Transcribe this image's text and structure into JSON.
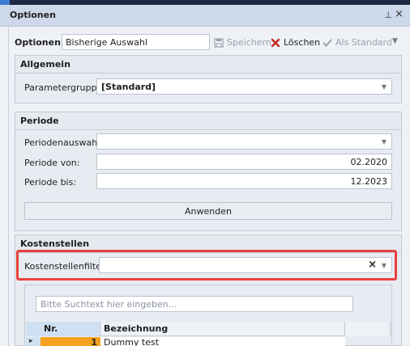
{
  "window": {
    "title": "Optionen",
    "pin_glyph": "⊥",
    "close_glyph": "×"
  },
  "options_bar": {
    "label": "Optionen:",
    "value": "Bisherige Auswahl",
    "save_label": "Speichern",
    "delete_label": "Löschen",
    "standard_label": "Als Standard",
    "icons": {
      "save": "save-icon",
      "delete": "delete-icon",
      "standard": "checkmark-icon"
    }
  },
  "allgemein": {
    "heading": "Allgemein",
    "param_label": "Parametergruppe:",
    "param_value": "[Standard]"
  },
  "periode": {
    "heading": "Periode",
    "auswahl_label": "Periodenauswahl:",
    "auswahl_value": "",
    "von_label": "Periode von:",
    "von_value": "02.2020",
    "bis_label": "Periode bis:",
    "bis_value": "12.2023",
    "apply_label": "Anwenden"
  },
  "kostenstellen": {
    "heading": "Kostenstellen",
    "filter_label": "Kostenstellenfilter:",
    "filter_value": "",
    "search_placeholder": "Bitte Suchtext hier eingeben...",
    "columns": [
      "Nr.",
      "Bezeichnung"
    ],
    "rows": [
      {
        "nr": "1",
        "bezeichnung": "Dummy test"
      }
    ]
  },
  "colors": {
    "accent": "#3d7bd1",
    "highlight": "#e8413d",
    "selected": "#f4a21f"
  }
}
